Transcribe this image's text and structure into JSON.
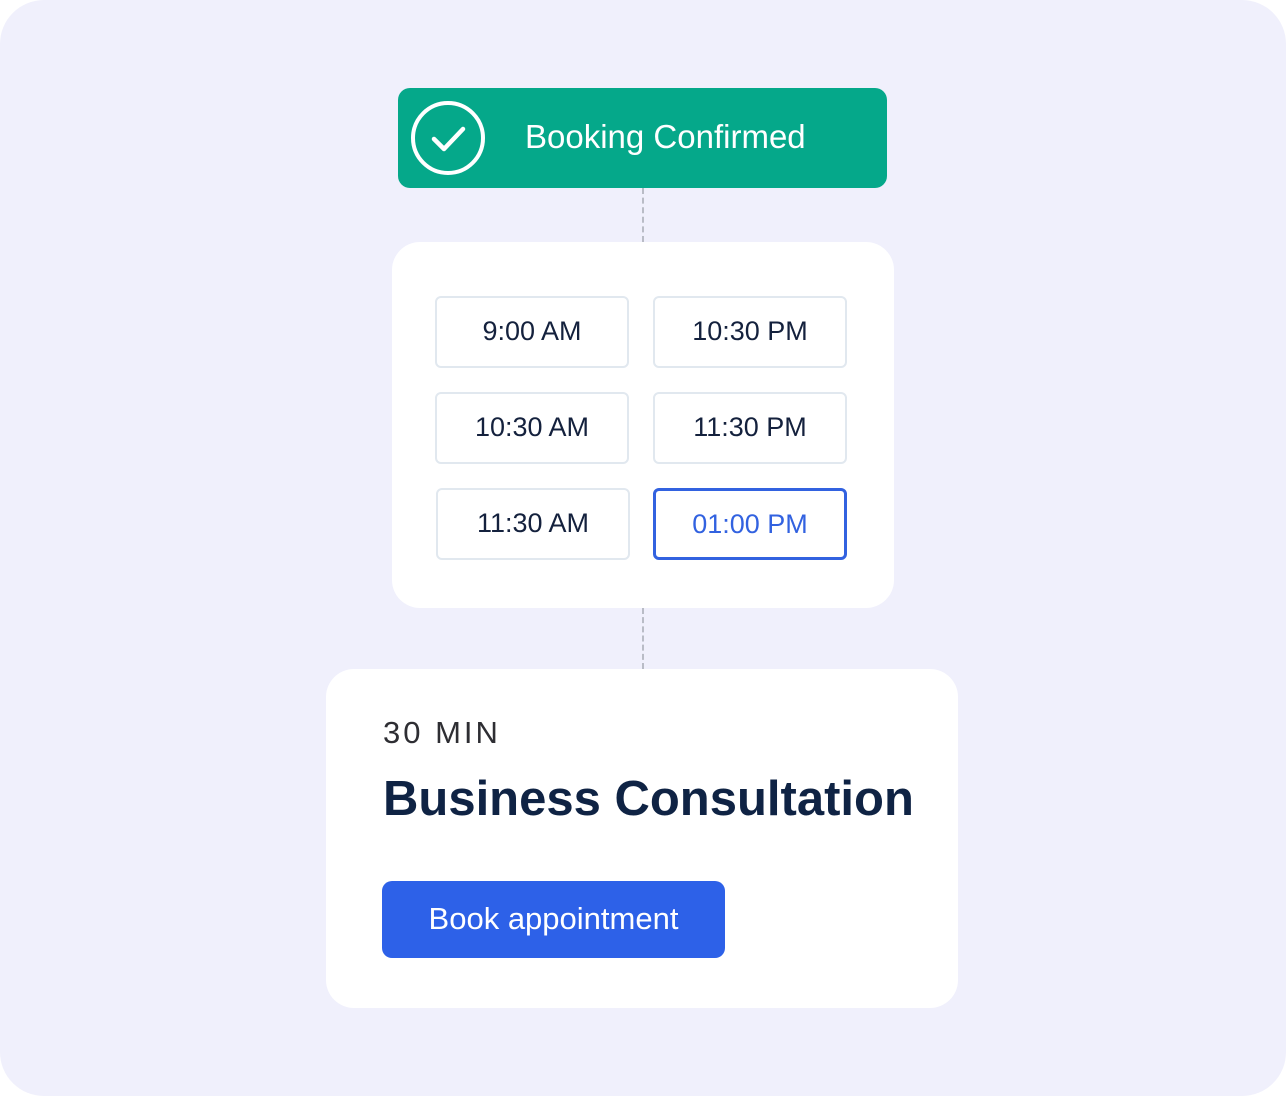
{
  "banner": {
    "title": "Booking Confirmed",
    "icon": "check-circle-icon",
    "color": "#05a88a"
  },
  "slots": [
    {
      "label": "9:00 AM",
      "selected": false
    },
    {
      "label": "10:30 PM",
      "selected": false
    },
    {
      "label": "10:30 AM",
      "selected": false
    },
    {
      "label": "11:30 PM",
      "selected": false
    },
    {
      "label": "11:30 AM",
      "selected": false
    },
    {
      "label": "01:00 PM",
      "selected": true
    }
  ],
  "details": {
    "duration": "30 MIN",
    "service_name": "Business Consultation",
    "book_button_label": "Book appointment"
  },
  "colors": {
    "background": "#f0f0fc",
    "accent": "#2d61e8",
    "selected_slot": "#3262e0",
    "success": "#05a88a",
    "heading_text": "#0f2344"
  }
}
